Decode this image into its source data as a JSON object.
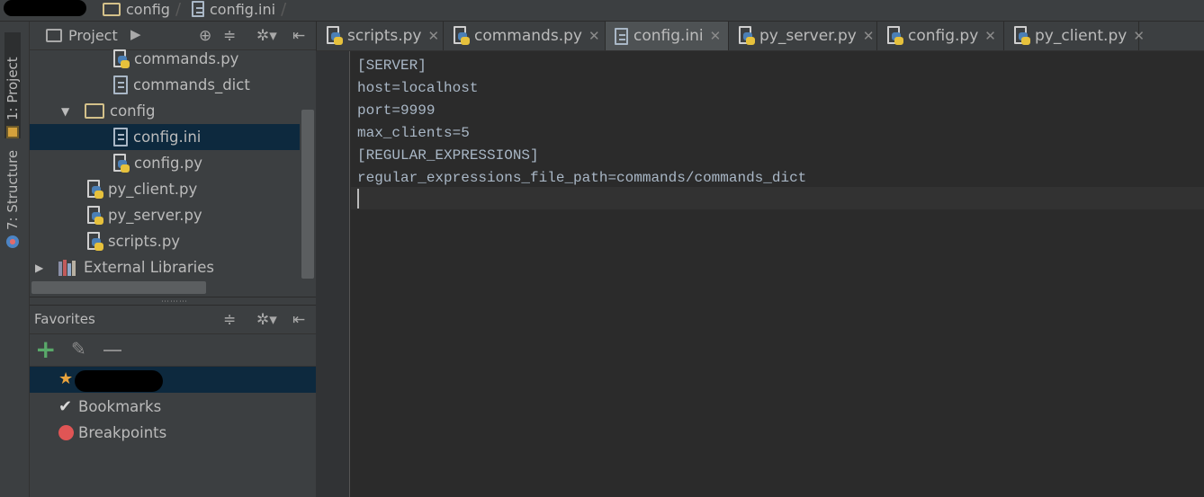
{
  "breadcrumb": {
    "items": [
      "config",
      "config.ini"
    ]
  },
  "toolstrip": {
    "project_tab": "1: Project",
    "structure_tab": "7: Structure"
  },
  "project_panel": {
    "header_label": "Project",
    "tree": [
      {
        "label": "commands.py",
        "type": "py"
      },
      {
        "label": "commands_dict",
        "type": "file"
      },
      {
        "label": "config",
        "type": "folder"
      },
      {
        "label": "config.ini",
        "type": "file"
      },
      {
        "label": "config.py",
        "type": "py"
      },
      {
        "label": "py_client.py",
        "type": "py"
      },
      {
        "label": "py_server.py",
        "type": "py"
      },
      {
        "label": "scripts.py",
        "type": "py"
      },
      {
        "label": "External Libraries",
        "type": "lib"
      }
    ]
  },
  "favorites_panel": {
    "header_label": "Favorites",
    "items": [
      {
        "label": "Bookmarks"
      },
      {
        "label": "Breakpoints"
      }
    ]
  },
  "editor": {
    "tabs": [
      {
        "label": "scripts.py",
        "type": "py"
      },
      {
        "label": "commands.py",
        "type": "py"
      },
      {
        "label": "config.ini",
        "type": "file"
      },
      {
        "label": "py_server.py",
        "type": "py"
      },
      {
        "label": "config.py",
        "type": "py"
      },
      {
        "label": "py_client.py",
        "type": "py"
      }
    ],
    "active_tab": "config.ini",
    "lines": [
      "[SERVER]",
      "host=localhost",
      "port=9999",
      "max_clients=5",
      "[REGULAR_EXPRESSIONS]",
      "regular_expressions_file_path=commands/commands_dict"
    ]
  },
  "icons": {
    "close": "close-icon",
    "gear": "gear-icon",
    "collapse": "collapse-all-icon",
    "locate": "locate-icon",
    "hide": "hide-panel-icon",
    "add": "add-icon",
    "edit": "edit-icon",
    "remove": "remove-icon",
    "star": "star-icon",
    "check": "check-icon",
    "breakpoint": "breakpoint-icon"
  },
  "colors": {
    "accent_selection": "#0d293e",
    "add_green": "#59a869",
    "breakpoint_red": "#e05555",
    "star_orange": "#e8a33d"
  }
}
